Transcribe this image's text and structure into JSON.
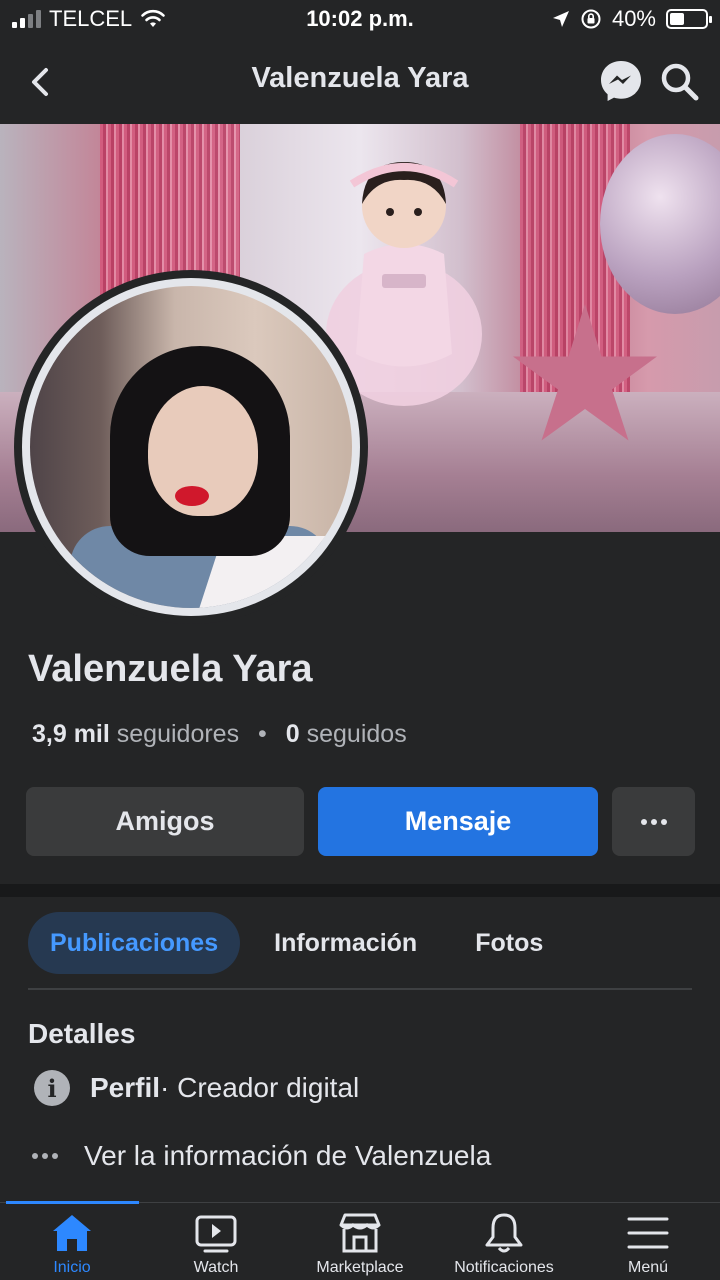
{
  "status_bar": {
    "carrier": "TELCEL",
    "time": "10:02 p.m.",
    "battery": "40%",
    "battery_level": 0.4
  },
  "header": {
    "title": "Valenzuela Yara",
    "back_icon": "back-arrow-icon",
    "messenger_icon": "messenger-icon",
    "search_icon": "search-icon"
  },
  "profile": {
    "name": "Valenzuela Yara",
    "followers_count": "3,9 mil",
    "followers_label": "seguidores",
    "separator": "•",
    "following_count": "0",
    "following_label": "seguidos"
  },
  "actions": {
    "friends_label": "Amigos",
    "message_label": "Mensaje",
    "more_icon": "more-dots-icon"
  },
  "tabs": [
    {
      "label": "Publicaciones",
      "active": true
    },
    {
      "label": "Información",
      "active": false
    },
    {
      "label": "Fotos",
      "active": false
    }
  ],
  "details": {
    "title": "Detalles",
    "profile_label": "Perfil",
    "profile_value": " · Creador digital",
    "see_more": "Ver la información de Valenzuela"
  },
  "bottom_nav": [
    {
      "label": "Inicio",
      "icon": "home-icon",
      "active": true
    },
    {
      "label": "Watch",
      "icon": "watch-icon",
      "active": false
    },
    {
      "label": "Marketplace",
      "icon": "marketplace-icon",
      "active": false
    },
    {
      "label": "Notificaciones",
      "icon": "bell-icon",
      "active": false
    },
    {
      "label": "Menú",
      "icon": "menu-icon",
      "active": false
    }
  ],
  "colors": {
    "background": "#242526",
    "accent": "#2374e1",
    "active_tab_bg": "#263951",
    "active_tab_text": "#4599ff"
  }
}
